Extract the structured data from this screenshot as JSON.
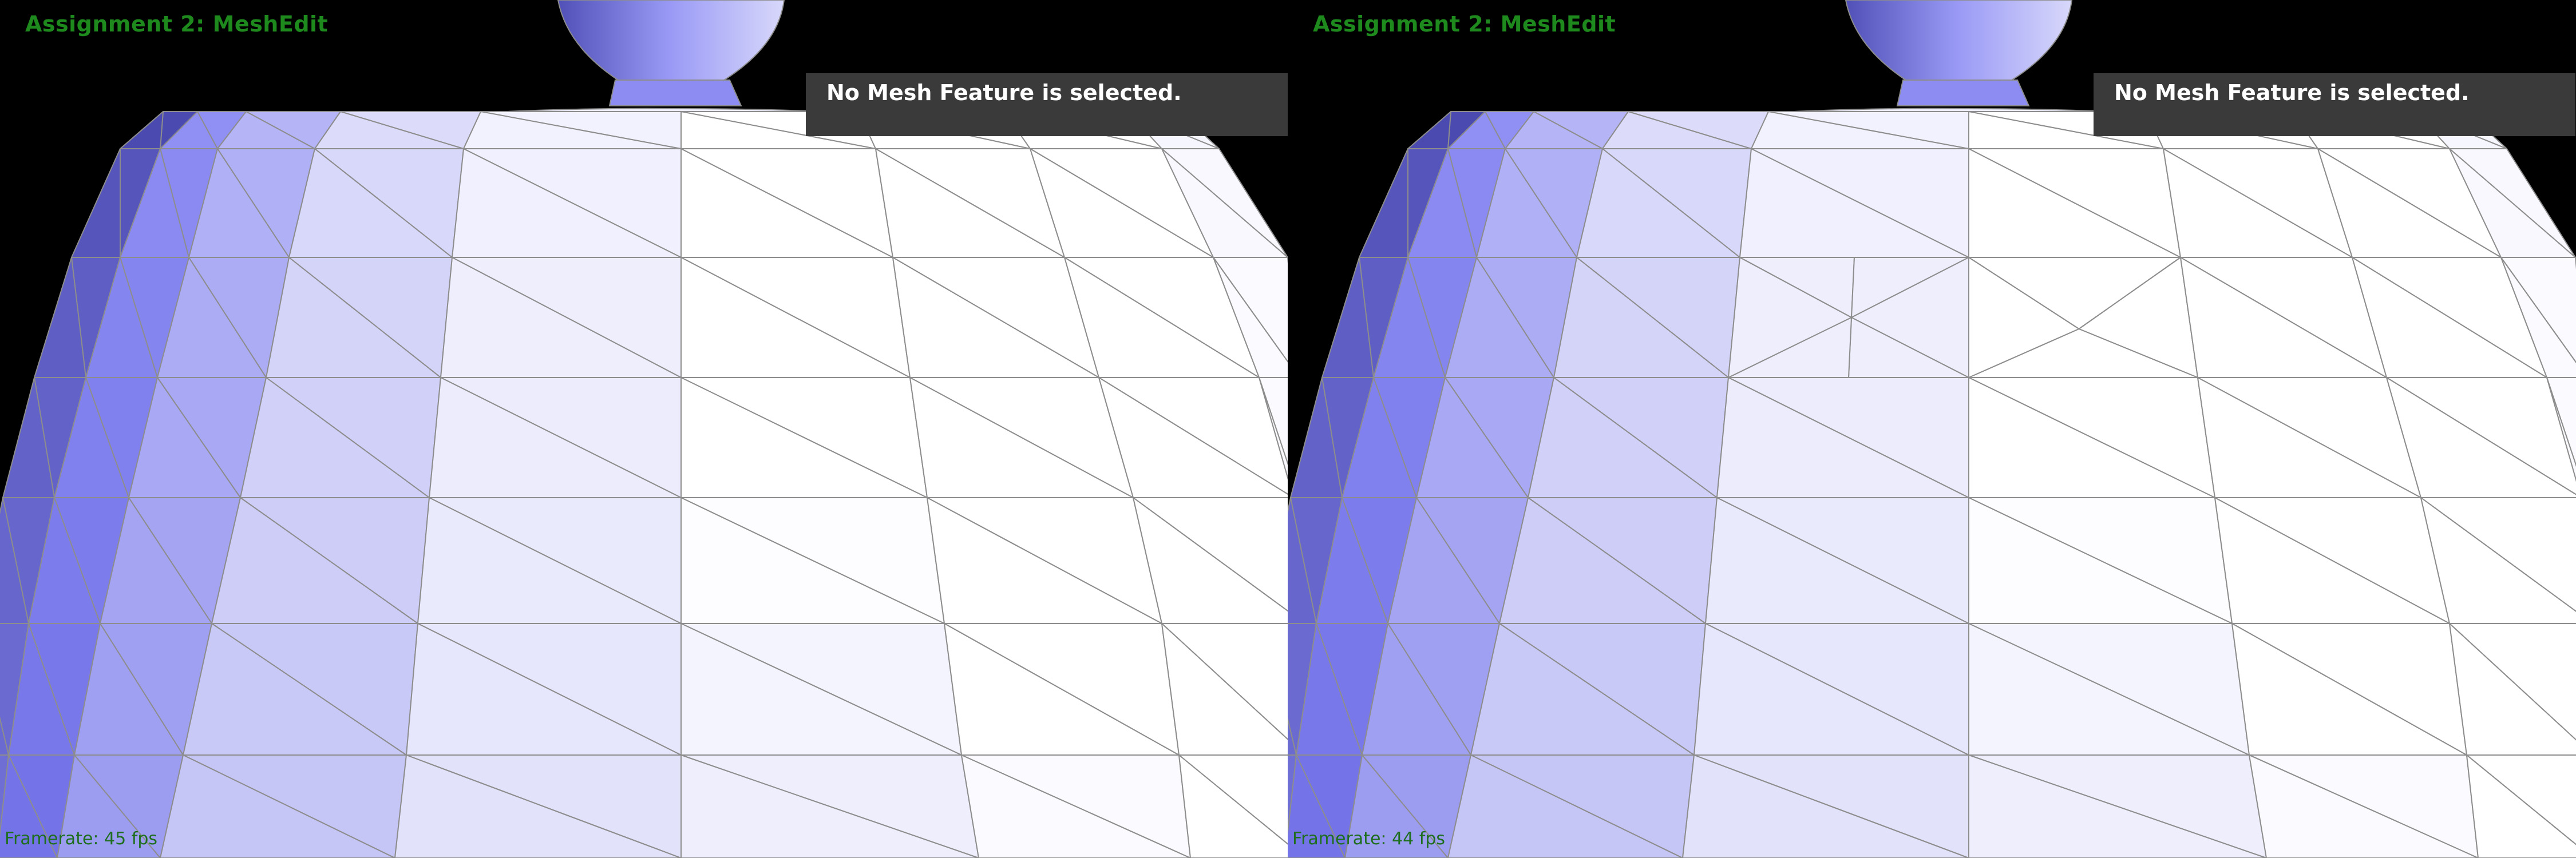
{
  "colors": {
    "title": "#1e8a1e",
    "framerate": "#1e6e1e",
    "background": "#000000",
    "wire": "#8d8d8d",
    "status_bg": "#3a3a3a"
  },
  "panels": [
    {
      "title": "Assignment 2: MeshEdit",
      "status": "No Mesh Feature is selected.",
      "framerate": "Framerate: 45 fps",
      "edited": false
    },
    {
      "title": "Assignment 2: MeshEdit",
      "status": "No Mesh Feature is selected.",
      "framerate": "Framerate: 44 fps",
      "edited": true
    }
  ]
}
